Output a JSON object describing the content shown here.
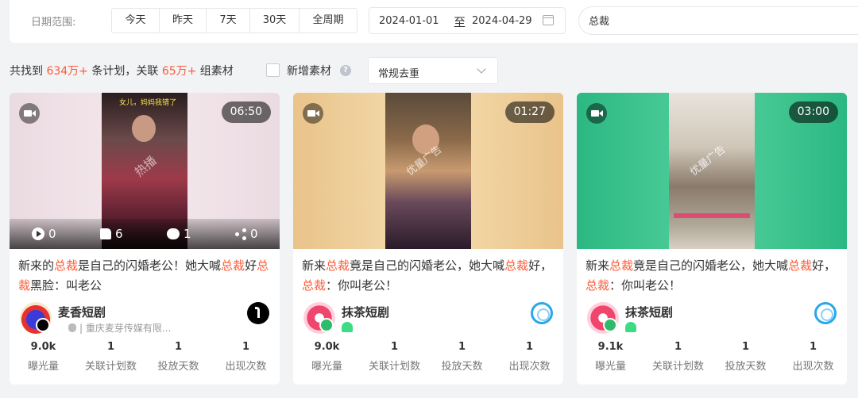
{
  "filters": {
    "date_label": "日期范围:",
    "ranges": [
      "今天",
      "昨天",
      "7天",
      "30天",
      "全周期"
    ],
    "start_date": "2024-01-01",
    "separator": "至",
    "end_date": "2024-04-29",
    "search_value": "总裁"
  },
  "summary": {
    "prefix": "共找到 ",
    "plans": "634万+",
    "mid": " 条计划，关联 ",
    "materials": "65万+",
    "suffix": " 组素材",
    "new_material_label": "新增素材",
    "help": "?",
    "dedupe_value": "常规去重"
  },
  "colors": {
    "highlight": "#ff5a37",
    "android": "#3ddc84",
    "accent_green": "#2fbc8a"
  },
  "cards": [
    {
      "duration": "06:50",
      "frame_caption": "女儿，妈妈我错了",
      "watermark": "热播",
      "stats": {
        "plays": "0",
        "likes": "6",
        "comments": "1",
        "shares": "0"
      },
      "title": [
        {
          "t": "新来的",
          "k": false
        },
        {
          "t": "总裁",
          "k": true
        },
        {
          "t": "是自己的闪婚老公！她大喊",
          "k": false
        },
        {
          "t": "总裁",
          "k": true
        },
        {
          "t": "好",
          "k": false
        },
        {
          "t": "总裁",
          "k": true
        },
        {
          "t": "黑脸：叫老公",
          "k": false
        }
      ],
      "author": "麦香短剧",
      "company": "| 重庆麦芽传媒有限...",
      "platform_icon": "tiktok-icon",
      "metrics": [
        {
          "value": "9.0k",
          "label": "曝光量"
        },
        {
          "value": "1",
          "label": "关联计划数"
        },
        {
          "value": "1",
          "label": "投放天数"
        },
        {
          "value": "1",
          "label": "出现次数"
        }
      ]
    },
    {
      "duration": "01:27",
      "frame_caption": "",
      "watermark": "优量广告",
      "title": [
        {
          "t": "新来",
          "k": false
        },
        {
          "t": "总裁",
          "k": true
        },
        {
          "t": "竟是自己的闪婚老公，她大喊",
          "k": false
        },
        {
          "t": "总裁",
          "k": true
        },
        {
          "t": "好，",
          "k": false
        },
        {
          "t": "总裁",
          "k": true
        },
        {
          "t": "：你叫老公！",
          "k": false
        }
      ],
      "author": "抹茶短剧",
      "platform_icon": "circle-app-icon",
      "metrics": [
        {
          "value": "9.0k",
          "label": "曝光量"
        },
        {
          "value": "1",
          "label": "关联计划数"
        },
        {
          "value": "1",
          "label": "投放天数"
        },
        {
          "value": "1",
          "label": "出现次数"
        }
      ]
    },
    {
      "duration": "03:00",
      "frame_caption": "",
      "watermark": "优量广告",
      "title": [
        {
          "t": "新来",
          "k": false
        },
        {
          "t": "总裁",
          "k": true
        },
        {
          "t": "竟是自己的闪婚老公，她大喊",
          "k": false
        },
        {
          "t": "总裁",
          "k": true
        },
        {
          "t": "好，",
          "k": false
        },
        {
          "t": "总裁",
          "k": true
        },
        {
          "t": "：你叫老公！",
          "k": false
        }
      ],
      "author": "抹茶短剧",
      "platform_icon": "circle-app-icon",
      "metrics": [
        {
          "value": "9.1k",
          "label": "曝光量"
        },
        {
          "value": "1",
          "label": "关联计划数"
        },
        {
          "value": "1",
          "label": "投放天数"
        },
        {
          "value": "1",
          "label": "出现次数"
        }
      ]
    }
  ]
}
